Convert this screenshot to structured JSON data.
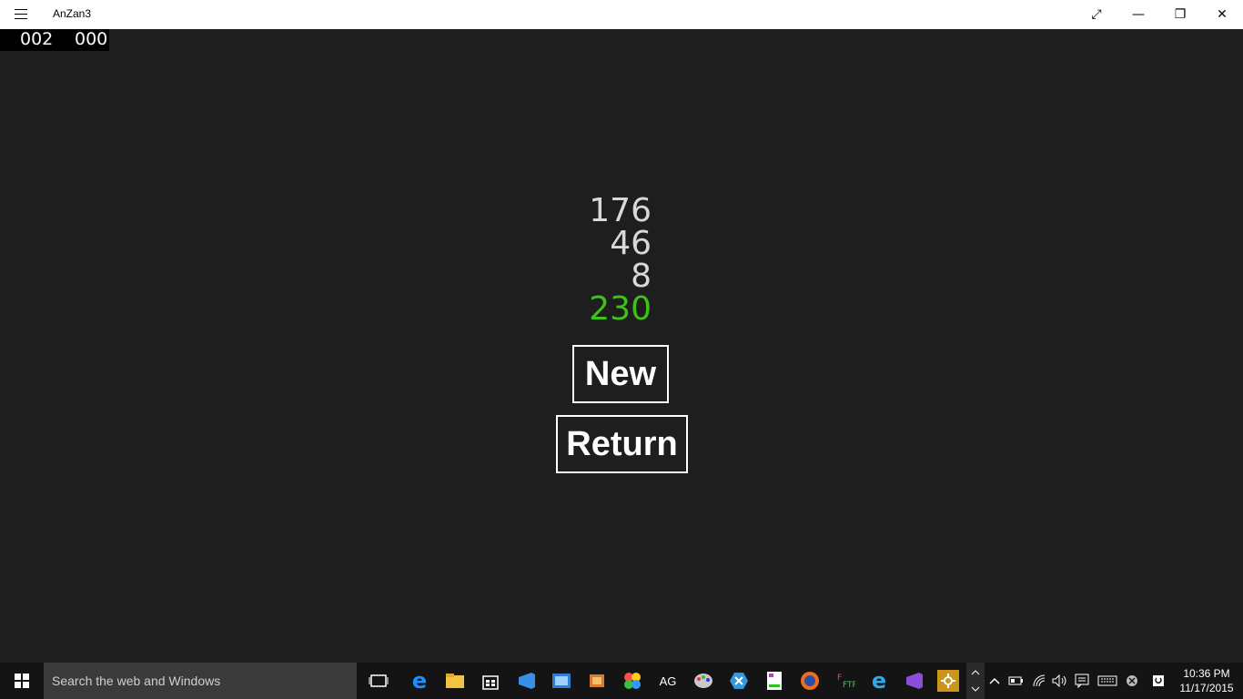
{
  "window": {
    "title": "AnZan3",
    "buttons": {
      "fullscreen": "⤢",
      "minimize": "—",
      "maximize": "❐",
      "close": "✕"
    }
  },
  "counters": {
    "left": "002",
    "right": "000"
  },
  "problem": {
    "numbers": [
      "176",
      "46",
      "8"
    ],
    "answer": "230",
    "answer_color": "#3ec21a"
  },
  "buttons": {
    "new_label": "New",
    "return_label": "Return"
  },
  "taskbar": {
    "search_placeholder": "Search the web and Windows",
    "pinned_icons": [
      "task-view-icon",
      "edge-icon",
      "file-explorer-icon",
      "store-icon",
      "visual-studio-icon",
      "outlook-icon",
      "paint-icon",
      "photos-icon",
      "ag-icon",
      "paint-palette-icon",
      "xamarin-icon",
      "notepad-icon",
      "firefox-icon",
      "ftp-icon",
      "internet-explorer-icon",
      "visual-studio-purple-icon",
      "settings-icon"
    ],
    "ag_label": "AG",
    "time": "10:36 PM",
    "date": "11/17/2015"
  }
}
